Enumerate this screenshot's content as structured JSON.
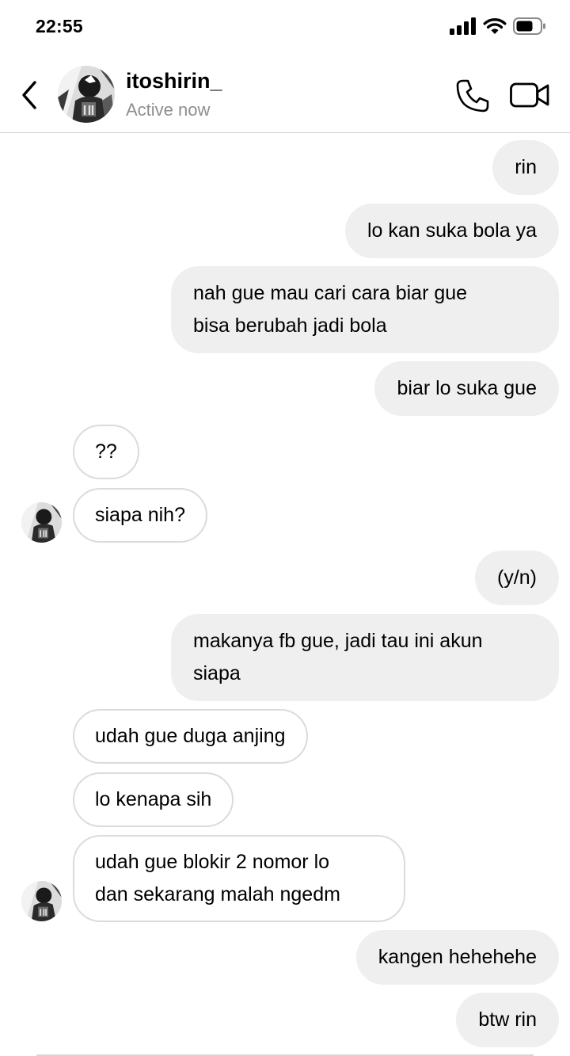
{
  "status_bar": {
    "time": "22:55",
    "icons": [
      "cellular-signal-icon",
      "wifi-icon",
      "battery-icon"
    ]
  },
  "header": {
    "back_icon": "chevron-left-icon",
    "contact_name": "itoshirin_",
    "contact_status": "Active now",
    "call_icon": "phone-icon",
    "video_icon": "video-camera-icon"
  },
  "messages": [
    {
      "from": "me",
      "text": "rin"
    },
    {
      "from": "me",
      "text": "lo kan suka bola ya"
    },
    {
      "from": "me",
      "text": "nah gue mau cari cara biar gue\nbisa berubah jadi bola"
    },
    {
      "from": "me",
      "text": "biar lo suka gue"
    },
    {
      "from": "them",
      "text": "??"
    },
    {
      "from": "them",
      "text": "siapa nih?"
    },
    {
      "from": "me",
      "text": "(y/n)"
    },
    {
      "from": "me",
      "text": "makanya fb gue, jadi tau ini akun\nsiapa"
    },
    {
      "from": "them",
      "text": "udah gue duga anjing"
    },
    {
      "from": "them",
      "text": "lo kenapa sih"
    },
    {
      "from": "them",
      "text": "udah gue blokir 2 nomor lo\ndan sekarang malah ngedm"
    },
    {
      "from": "me",
      "text": "kangen hehehehe"
    },
    {
      "from": "me",
      "text": "btw rin"
    }
  ],
  "colors": {
    "outgoing_bubble": "#efefef",
    "incoming_border": "#dbdbdb",
    "secondary_text": "#8e8e8e"
  }
}
